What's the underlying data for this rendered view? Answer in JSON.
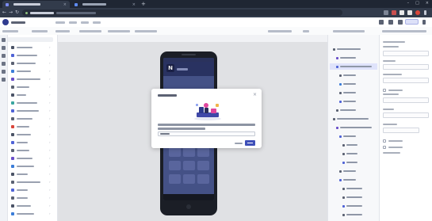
{
  "browser": {
    "tabs": [
      {
        "label": "",
        "active": true
      },
      {
        "label": "",
        "active": false
      }
    ],
    "address": ""
  },
  "dialog": {
    "title": "",
    "message": "",
    "input_value": "",
    "cancel_label": "",
    "create_label": ""
  },
  "phone": {
    "logo_text": "N",
    "tile_rows": 6,
    "tile_cols": 3
  },
  "colors": {
    "browser_chrome": "#1f2633",
    "phone_screen": "#48568f",
    "phone_appbar": "#2b3567",
    "accent": "#3e4fb8",
    "selection": "#dfe3fb"
  },
  "icons": [
    "back-icon",
    "forward-icon",
    "reload-icon",
    "lock-icon",
    "close-icon",
    "chevron-right-icon",
    "undo-icon",
    "redo-icon",
    "preview-icon"
  ]
}
